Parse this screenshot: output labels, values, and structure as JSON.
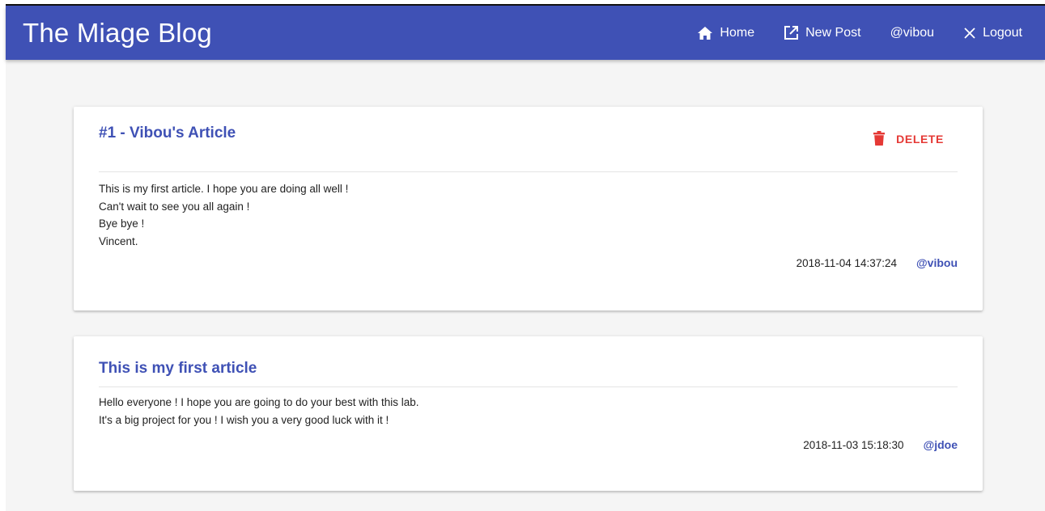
{
  "app": {
    "title": "The Miage Blog"
  },
  "nav": {
    "home_label": "Home",
    "new_post_label": "New Post",
    "user_label": "@vibou",
    "logout_label": "Logout"
  },
  "colors": {
    "primary": "#3f51b5",
    "danger": "#e53935",
    "background": "#f5f5f5"
  },
  "posts": [
    {
      "title": "#1 - Vibou's Article",
      "delete_label": "DELETE",
      "lines": [
        "This is my first article. I hope you are doing all well !",
        "Can't wait to see you all again !",
        "Bye bye !",
        "Vincent."
      ],
      "date": "2018-11-04 14:37:24",
      "author": "@vibou"
    },
    {
      "title": "This is my first article",
      "lines": [
        "Hello everyone ! I hope you are going to do your best with this lab.",
        "It's a big project for you ! I wish you a very good luck with it !"
      ],
      "date": "2018-11-03 15:18:30",
      "author": "@jdoe"
    }
  ]
}
